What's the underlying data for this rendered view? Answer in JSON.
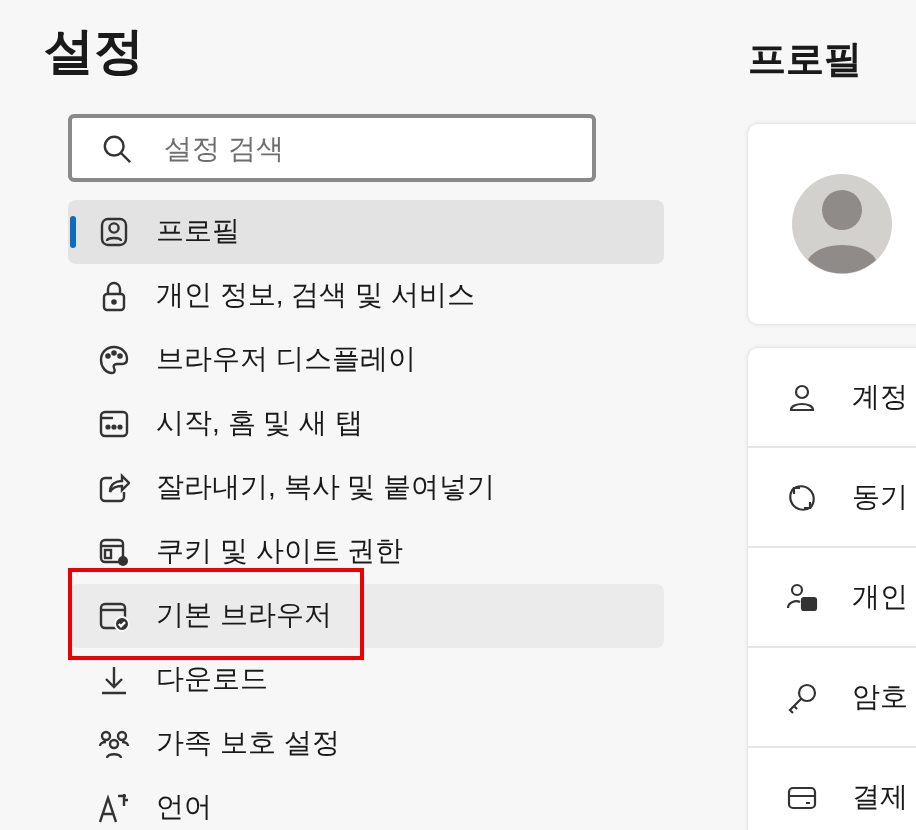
{
  "sidebar": {
    "title": "설정",
    "search": {
      "placeholder": "설정 검색"
    },
    "items": [
      {
        "label": "프로필",
        "selected": true,
        "hovered": false,
        "highlighted": false
      },
      {
        "label": "개인 정보, 검색 및 서비스",
        "selected": false,
        "hovered": false,
        "highlighted": false
      },
      {
        "label": "브라우저 디스플레이",
        "selected": false,
        "hovered": false,
        "highlighted": false
      },
      {
        "label": "시작, 홈 및 새 탭",
        "selected": false,
        "hovered": false,
        "highlighted": false
      },
      {
        "label": "잘라내기, 복사 및 붙여넣기",
        "selected": false,
        "hovered": false,
        "highlighted": false
      },
      {
        "label": "쿠키 및 사이트 권한",
        "selected": false,
        "hovered": false,
        "highlighted": false
      },
      {
        "label": "기본 브라우저",
        "selected": false,
        "hovered": true,
        "highlighted": true
      },
      {
        "label": "다운로드",
        "selected": false,
        "hovered": false,
        "highlighted": false
      },
      {
        "label": "가족 보호 설정",
        "selected": false,
        "hovered": false,
        "highlighted": false
      },
      {
        "label": "언어",
        "selected": false,
        "hovered": false,
        "highlighted": false
      }
    ]
  },
  "main": {
    "title": "프로필",
    "rows": [
      {
        "label": "계정"
      },
      {
        "label": "동기"
      },
      {
        "label": "개인"
      },
      {
        "label": "암호"
      },
      {
        "label": "결제"
      }
    ]
  }
}
